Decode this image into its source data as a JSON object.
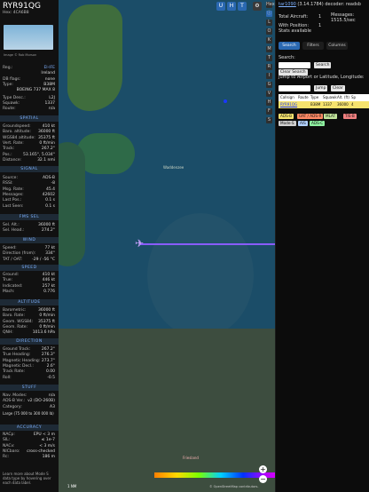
{
  "aircraft": {
    "callsign": "RYR91QG",
    "hex_prefix": "Hex:",
    "hex": "4CA6B8",
    "image_credit": "Image © Rob Morson",
    "registration": "EI-IFE",
    "country": "Ireland",
    "db_flags": "none",
    "type": "B38M",
    "type_desc": "BOEING 737 MAX 8",
    "type_desc_label": "L2J",
    "squawk": "1337",
    "route": "n/a"
  },
  "sections": {
    "spatial": "SPATIAL",
    "signal": "SIGNAL",
    "fms": "FMS SEL",
    "wind": "WIND",
    "speed": "SPEED",
    "altitude": "ALTITUDE",
    "direction": "DIRECTION",
    "stuff": "STUFF",
    "accuracy": "ACCURACY"
  },
  "spatial": [
    {
      "label": "Groundspeed:",
      "value": "410 kt"
    },
    {
      "label": "Baro. altitude:",
      "value": "36000 ft"
    },
    {
      "label": "WGS84 altitude:",
      "value": "35375 ft"
    },
    {
      "label": "Vert. Rate:",
      "value": "0 ft/min"
    },
    {
      "label": "Track:",
      "value": "267.2°"
    },
    {
      "label": "Pos.:",
      "value": "53.165°, 5.034°"
    },
    {
      "label": "Distance:",
      "value": "32.1 nmi"
    }
  ],
  "signal": [
    {
      "label": "Source:",
      "value": "ADS-B"
    },
    {
      "label": "RSSI:",
      "value": "-8"
    },
    {
      "label": "Msg. Rate:",
      "value": "45.4"
    },
    {
      "label": "Messages:",
      "value": "42602"
    },
    {
      "label": "Last Pos.:",
      "value": "0.1 s"
    },
    {
      "label": "Last Seen:",
      "value": "0.1 s"
    }
  ],
  "fms": [
    {
      "label": "Sel. Alt.:",
      "value": "36000 ft"
    },
    {
      "label": "Sel. Head.:",
      "value": "274.2°"
    }
  ],
  "wind": [
    {
      "label": "Speed:",
      "value": "77 kt"
    },
    {
      "label": "Direction (from):",
      "value": "334°"
    },
    {
      "label": "TAT / OAT:",
      "value": "-29 / -56 °C"
    }
  ],
  "speed": [
    {
      "label": "Ground:",
      "value": "410 kt"
    },
    {
      "label": "True:",
      "value": "446 kt"
    },
    {
      "label": "Indicated:",
      "value": "257 kt"
    },
    {
      "label": "Mach:",
      "value": "0.776"
    }
  ],
  "altitude": [
    {
      "label": "Barometric:",
      "value": "36000 ft"
    },
    {
      "label": "Baro. Rate:",
      "value": "0 ft/min"
    },
    {
      "label": "Geom. WGS84:",
      "value": "35375 ft"
    },
    {
      "label": "Geom. Rate:",
      "value": "0 ft/min"
    },
    {
      "label": "QNH:",
      "value": "1013.6 hPa"
    }
  ],
  "direction": [
    {
      "label": "Ground Track:",
      "value": "267.2°"
    },
    {
      "label": "True Heading:",
      "value": "276.3°"
    },
    {
      "label": "Magnetic Heading:",
      "value": "273.7°"
    },
    {
      "label": "Magnetic Decl.:",
      "value": "2.6°"
    },
    {
      "label": "Track Rate:",
      "value": "0.00"
    },
    {
      "label": "Roll:",
      "value": "-0.5"
    }
  ],
  "stuff": [
    {
      "label": "Nav. Modes:",
      "value": "n/a"
    },
    {
      "label": "ADS-B Ver.:",
      "value": "v2 (DO-260B)"
    },
    {
      "label": "Category:",
      "value": "A3"
    }
  ],
  "stuff_extra": "Large (75 000 to 300 000 lb)",
  "accuracy": [
    {
      "label": "NACp:",
      "value": "EPU < 3 m"
    },
    {
      "label": "SIL:",
      "value": "≤ 1e-7"
    },
    {
      "label": "NACv:",
      "value": "< 3 m/s"
    },
    {
      "label": "NICbaro:",
      "value": "cross-checked"
    },
    {
      "label": "Rc:",
      "value": "186 m"
    }
  ],
  "learn_more": "Learn more about Mode S data type by hovering over each data label.",
  "side_buttons": [
    "Hex",
    "ⓘ",
    "L",
    "O",
    "K",
    "M",
    "T",
    "R",
    "I",
    "G",
    "V",
    "H",
    "F",
    "S"
  ],
  "map_buttons": [
    "U",
    "H",
    "T"
  ],
  "map_labels": {
    "sea1": "Waddenzee",
    "sea2": "Friesland"
  },
  "bottom_left": "1 NM",
  "copyright": "© OpenStreetMap contributors.",
  "right": {
    "title": "tar1090",
    "version": "(3.14.1784) decoder: readsb",
    "total_label": "Total Aircraft:",
    "total": "1",
    "messages_label": "Messages:",
    "messages": "1515.5/sec",
    "with_pos_label": "With Position:",
    "with_pos": "1",
    "stats": "Stats available",
    "tabs": [
      {
        "label": "Search",
        "active": true
      },
      {
        "label": "Filters",
        "active": false
      },
      {
        "label": "Columns",
        "active": false
      }
    ],
    "search_label": "Search:",
    "search_btn": "Search",
    "clear_search": "Clear Search",
    "jump_label": "Jump to Airport or Latitude, Longitude:",
    "jump_btn": "Jump",
    "clear_btn": "Clear",
    "table_headers": [
      "Callsign",
      "Route",
      "Type",
      "Squawk",
      "Alt. (ft)",
      "Sp"
    ],
    "table_row": [
      "RYR91QG",
      "",
      "B38M",
      "1337",
      "36000",
      "4"
    ],
    "badges": [
      {
        "label": "ADS-B",
        "bg": "#f6e36e"
      },
      {
        "label": "UAT / ADS-R",
        "bg": "#ff8a65"
      },
      {
        "label": "MLAT",
        "bg": "#c2e59c"
      },
      {
        "label": "TIS-B",
        "bg": "#f08080"
      },
      {
        "label": "Mode-S",
        "bg": "#d0d0d0"
      },
      {
        "label": "AIS",
        "bg": "#b0d0ff"
      },
      {
        "label": "ADS-C",
        "bg": "#8ef0a0"
      }
    ]
  }
}
